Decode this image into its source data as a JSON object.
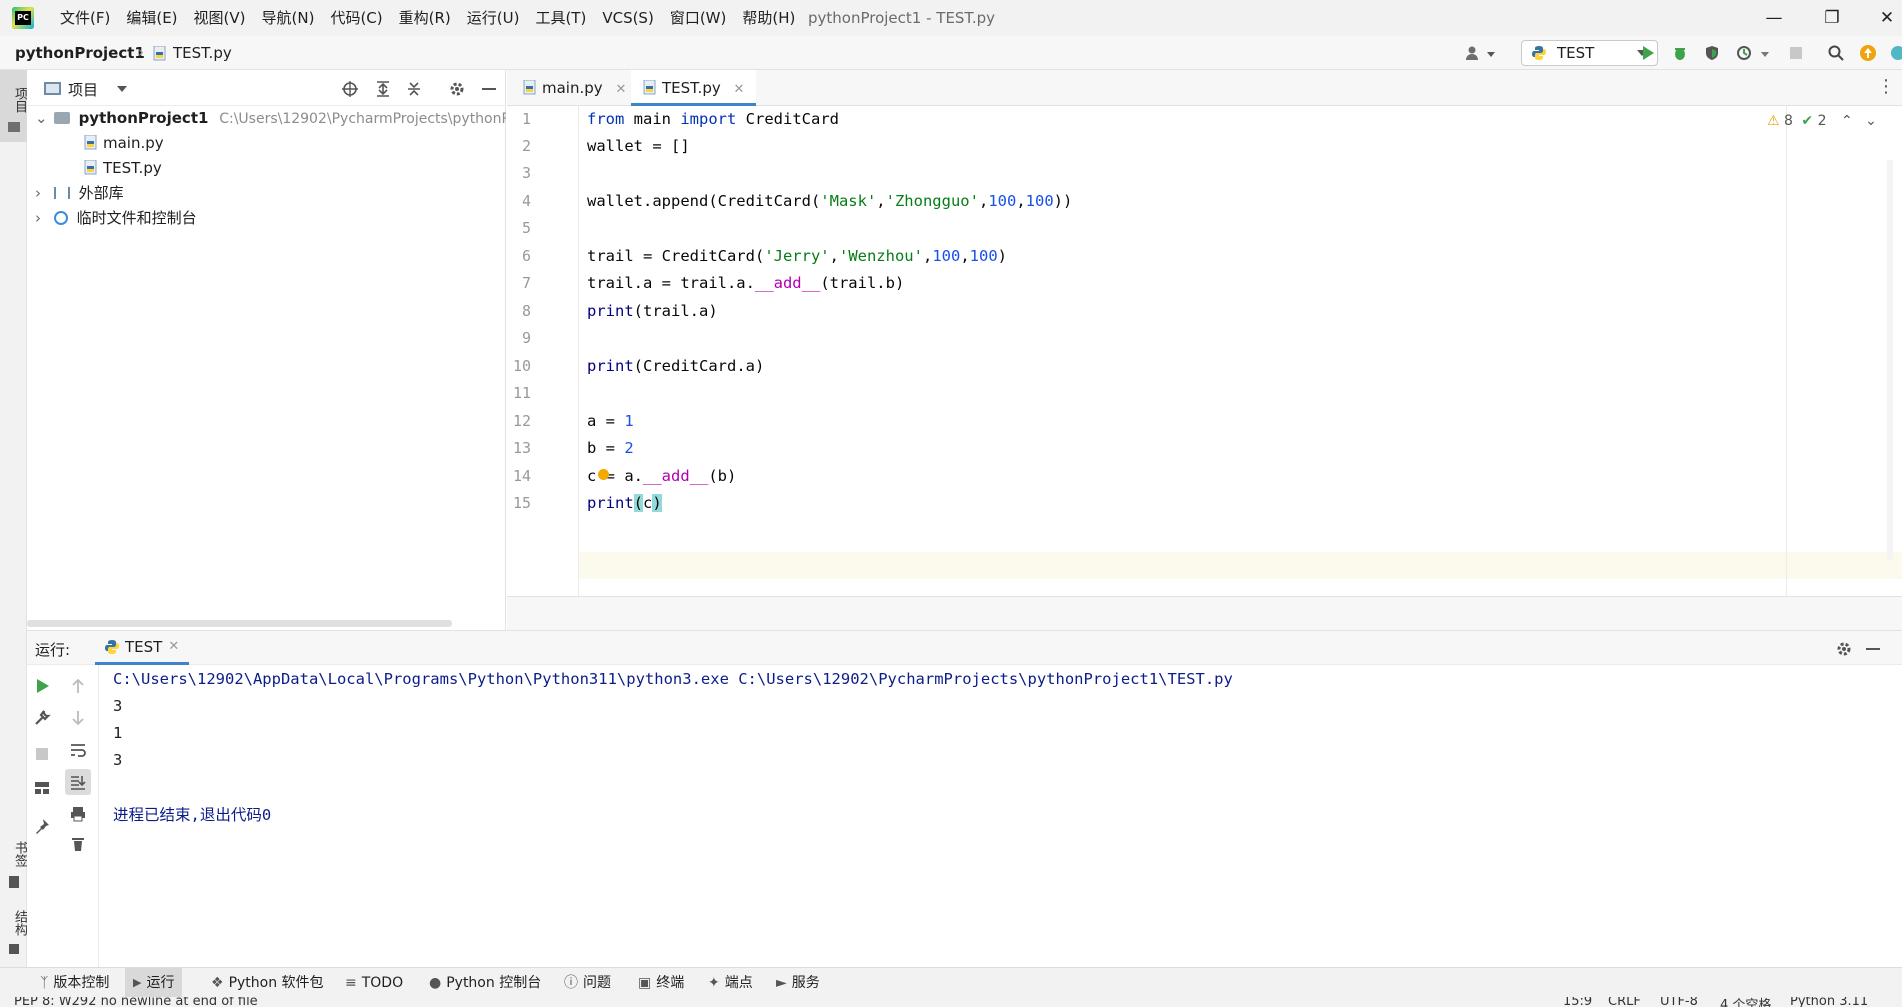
{
  "window": {
    "title": "pythonProject1 - TEST.py",
    "menu": [
      "文件(F)",
      "编辑(E)",
      "视图(V)",
      "导航(N)",
      "代码(C)",
      "重构(R)",
      "运行(U)",
      "工具(T)",
      "VCS(S)",
      "窗口(W)",
      "帮助(H)"
    ]
  },
  "navbar": {
    "project": "pythonProject1",
    "file": "TEST.py",
    "run_config": "TEST"
  },
  "left_strip": {
    "project_tab": "项目",
    "bookmarks_tab": "书签",
    "structure_tab": "结构"
  },
  "project_panel": {
    "title": "项目",
    "root": {
      "name": "pythonProject1",
      "path": "C:\\Users\\12902\\PycharmProjects\\pythonP"
    },
    "files": [
      "main.py",
      "TEST.py"
    ],
    "external_libs": "外部库",
    "scratches": "临时文件和控制台"
  },
  "editor": {
    "tabs": [
      {
        "label": "main.py",
        "active": false
      },
      {
        "label": "TEST.py",
        "active": true
      }
    ],
    "line_numbers": [
      "1",
      "2",
      "3",
      "4",
      "5",
      "6",
      "7",
      "8",
      "9",
      "10",
      "11",
      "12",
      "13",
      "14",
      "15"
    ],
    "inspection": {
      "warnings": "8",
      "weak": "2"
    }
  },
  "run_panel": {
    "label": "运行:",
    "tab": "TEST",
    "output": [
      "C:\\Users\\12902\\AppData\\Local\\Programs\\Python\\Python311\\python3.exe C:\\Users\\12902\\PycharmProjects\\pythonProject1\\TEST.py",
      "3",
      "1",
      "3",
      "",
      "进程已结束,退出代码0"
    ]
  },
  "bottom_bar": [
    "版本控制",
    "运行",
    "Python 软件包",
    "TODO",
    "Python 控制台",
    "问题",
    "终端",
    "端点",
    "服务"
  ],
  "status": {
    "message": "PEP 8: W292 no newline at end of file",
    "position": "15:9",
    "line_sep": "CRLF",
    "encoding": "UTF-8",
    "indent": "4 个空格",
    "interpreter": "Python 3.11"
  },
  "colors": {
    "accent": "#4083c9",
    "keyword": "#0033b3",
    "string": "#067d17",
    "number": "#1750eb",
    "dunder": "#b200b2",
    "run_green": "#3fa34d"
  }
}
